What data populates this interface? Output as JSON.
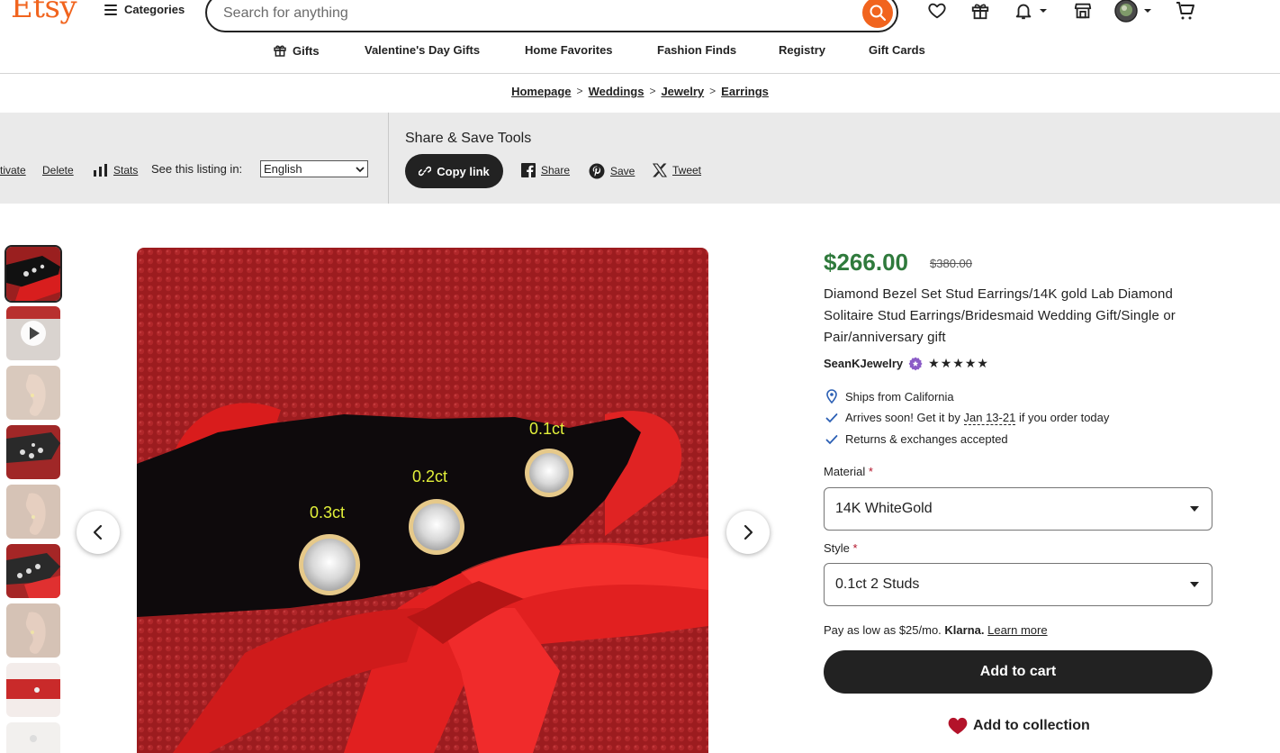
{
  "header": {
    "logo": "Etsy",
    "categories_label": "Categories",
    "search_placeholder": "Search for anything"
  },
  "nav": {
    "items": [
      "Gifts",
      "Valentine's Day Gifts",
      "Home Favorites",
      "Fashion Finds",
      "Registry",
      "Gift Cards"
    ]
  },
  "breadcrumb": [
    "Homepage",
    "Weddings",
    "Jewelry",
    "Earrings"
  ],
  "tools": {
    "deactivate_label": "tivate",
    "delete_label": "Delete",
    "stats_label": "Stats",
    "see_listing_label": "See this listing in:",
    "language": "English",
    "share_title": "Share & Save Tools",
    "copy_link_label": "Copy link",
    "share_label": "Share",
    "save_label": "Save",
    "tweet_label": "Tweet"
  },
  "image": {
    "labels": [
      "0.3ct",
      "0.2ct",
      "0.1ct"
    ]
  },
  "product": {
    "price": "$266.00",
    "original_price": "$380.00",
    "title": "Diamond Bezel Set Stud Earrings/14K gold Lab Diamond Solitaire Stud Earrings/Bridesmaid Wedding Gift/Single or Pair/anniversary gift",
    "shop_name": "SeanKJewelry",
    "stars": "★★★★★",
    "ships_from": "Ships from California",
    "arrives_prefix": "Arrives soon! Get it by ",
    "arrives_dates": "Jan 13-21",
    "arrives_suffix": " if you order today",
    "returns": "Returns & exchanges accepted",
    "material_label": "Material",
    "material_value": "14K WhiteGold",
    "style_label": "Style",
    "style_value": "0.1ct 2 Studs",
    "required_mark": "*",
    "klarna_prefix": "Pay as low as $25/mo. ",
    "klarna_brand": "Klarna.",
    "klarna_learn": "Learn more",
    "add_to_cart": "Add to cart",
    "add_to_collection": "Add to collection"
  },
  "colors": {
    "brand_orange": "#f1641e",
    "price_green": "#2f7a3c",
    "required_red": "#b3132a",
    "heart_red": "#b3132a",
    "dark": "#222222",
    "star_seller_purple": "#8b5cc7"
  }
}
